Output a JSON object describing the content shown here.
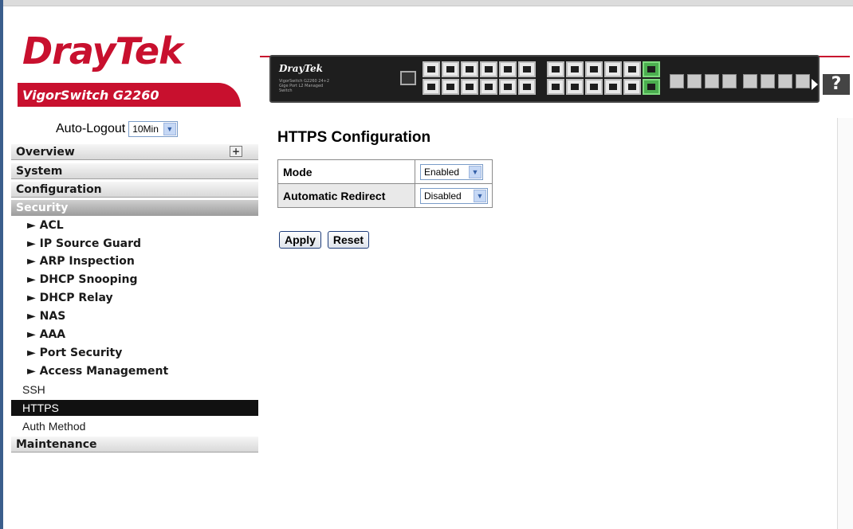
{
  "header": {
    "brand": "DrayTek",
    "model": "VigorSwitch G2260",
    "switch_brand": "DrayTek",
    "switch_sub": "VigorSwitch G2260 24+2 Gige Port L2 Managed Switch",
    "help_label": "?"
  },
  "sidebar": {
    "autologout_label": "Auto-Logout",
    "autologout_value": "10Min",
    "sections": {
      "overview": "Overview",
      "system": "System",
      "configuration": "Configuration",
      "security": "Security",
      "maintenance": "Maintenance"
    },
    "security_items": [
      "► ACL",
      "► IP Source Guard",
      "► ARP Inspection",
      "► DHCP Snooping",
      "► DHCP Relay",
      "► NAS",
      "► AAA",
      "► Port Security",
      "► Access Management"
    ],
    "plain_items": {
      "ssh": "SSH",
      "https": "HTTPS",
      "auth": "Auth Method"
    }
  },
  "main": {
    "title": "HTTPS Configuration",
    "rows": [
      {
        "label": "Mode",
        "value": "Enabled"
      },
      {
        "label": "Automatic Redirect",
        "value": "Disabled"
      }
    ],
    "apply_label": "Apply",
    "reset_label": "Reset"
  },
  "colors": {
    "brand_red": "#c8102e",
    "selected_bg": "#111111"
  }
}
